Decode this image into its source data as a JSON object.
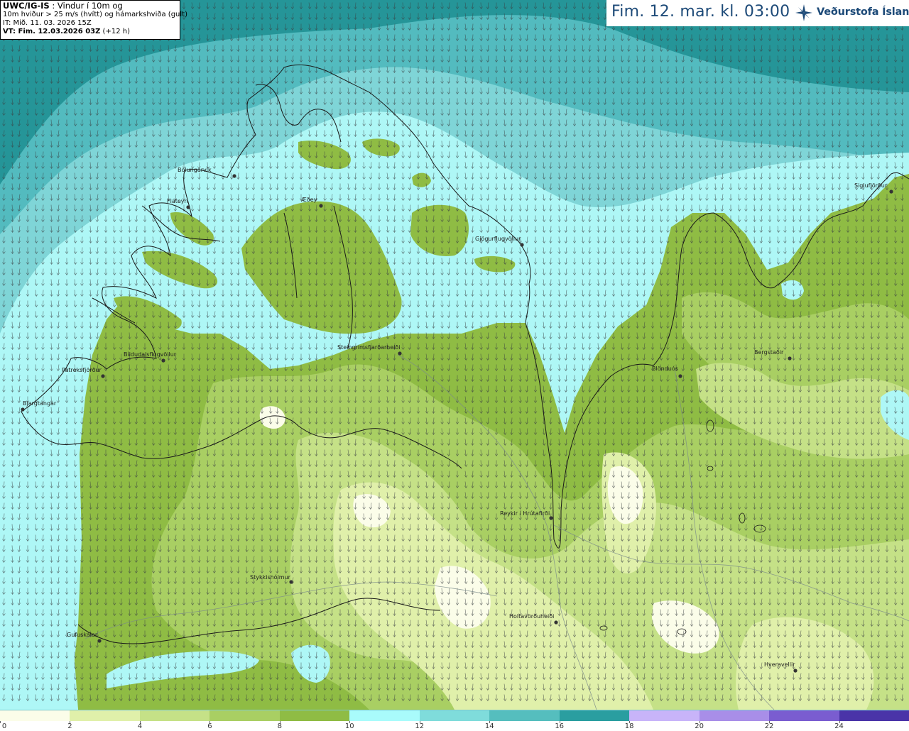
{
  "info": {
    "model": "UWC/IG-IS",
    "line1_rest": " : Vindur í 10m og",
    "line2": "10m hviður > 25 m/s (hvítt) og hámarkshviða (gult)",
    "line3": "IT: Mið. 11. 03. 2026 15Z",
    "line4_bold": "VT: Fim. 12.03.2026 03Z",
    "line4_rest": " (+12 h)"
  },
  "header": {
    "valid_time": "Fim. 12. mar. kl. 03:00",
    "logo_name": "Veðurstofa Íslands",
    "logo_icon": "vedurstofa-logo-icon"
  },
  "places": [
    {
      "name": "Bolungarvík"
    },
    {
      "name": "Flateyri"
    },
    {
      "name": "Æðey"
    },
    {
      "name": "Gjögurflugvöllur"
    },
    {
      "name": "Siglufjörður"
    },
    {
      "name": "Steingrímsfjarðarheiði"
    },
    {
      "name": "Patreksfjörður"
    },
    {
      "name": "Bíldudalsflugvöllur"
    },
    {
      "name": "Bjargtangar"
    },
    {
      "name": "Blönduós"
    },
    {
      "name": "Bergstaðir"
    },
    {
      "name": "Reykir í Hrútafirði"
    },
    {
      "name": "Stykkishólmur"
    },
    {
      "name": "Holtavörðuheiði"
    },
    {
      "name": "Gufuskálar"
    },
    {
      "name": "Hveravellir"
    }
  ],
  "colorbar": {
    "unit_labels": [
      "0",
      "2",
      "4",
      "6",
      "8",
      "10",
      "12",
      "14",
      "16",
      "18",
      "20",
      "22",
      "24"
    ],
    "colors": [
      "#fbfde9",
      "#e0f0aa",
      "#c5e187",
      "#a9cf63",
      "#8fbc44",
      "#a9fbfb",
      "#7fdcdb",
      "#55bebe",
      "#2a9ea0",
      "#c8b4f9",
      "#a88ee8",
      "#7a5dd0",
      "#4a34a8",
      "#f7a3a3"
    ]
  },
  "zone_colors": {
    "sea_deep": "#259598",
    "sea_mid": "#53bbbf",
    "sea_light": "#7fd5d7",
    "cyan": "#aef7f6",
    "green_dark": "#8fbc44",
    "green_mid": "#a9cf63",
    "green_light": "#c5e187",
    "yellow_green": "#e0f0aa",
    "cream": "#fbfde9"
  }
}
